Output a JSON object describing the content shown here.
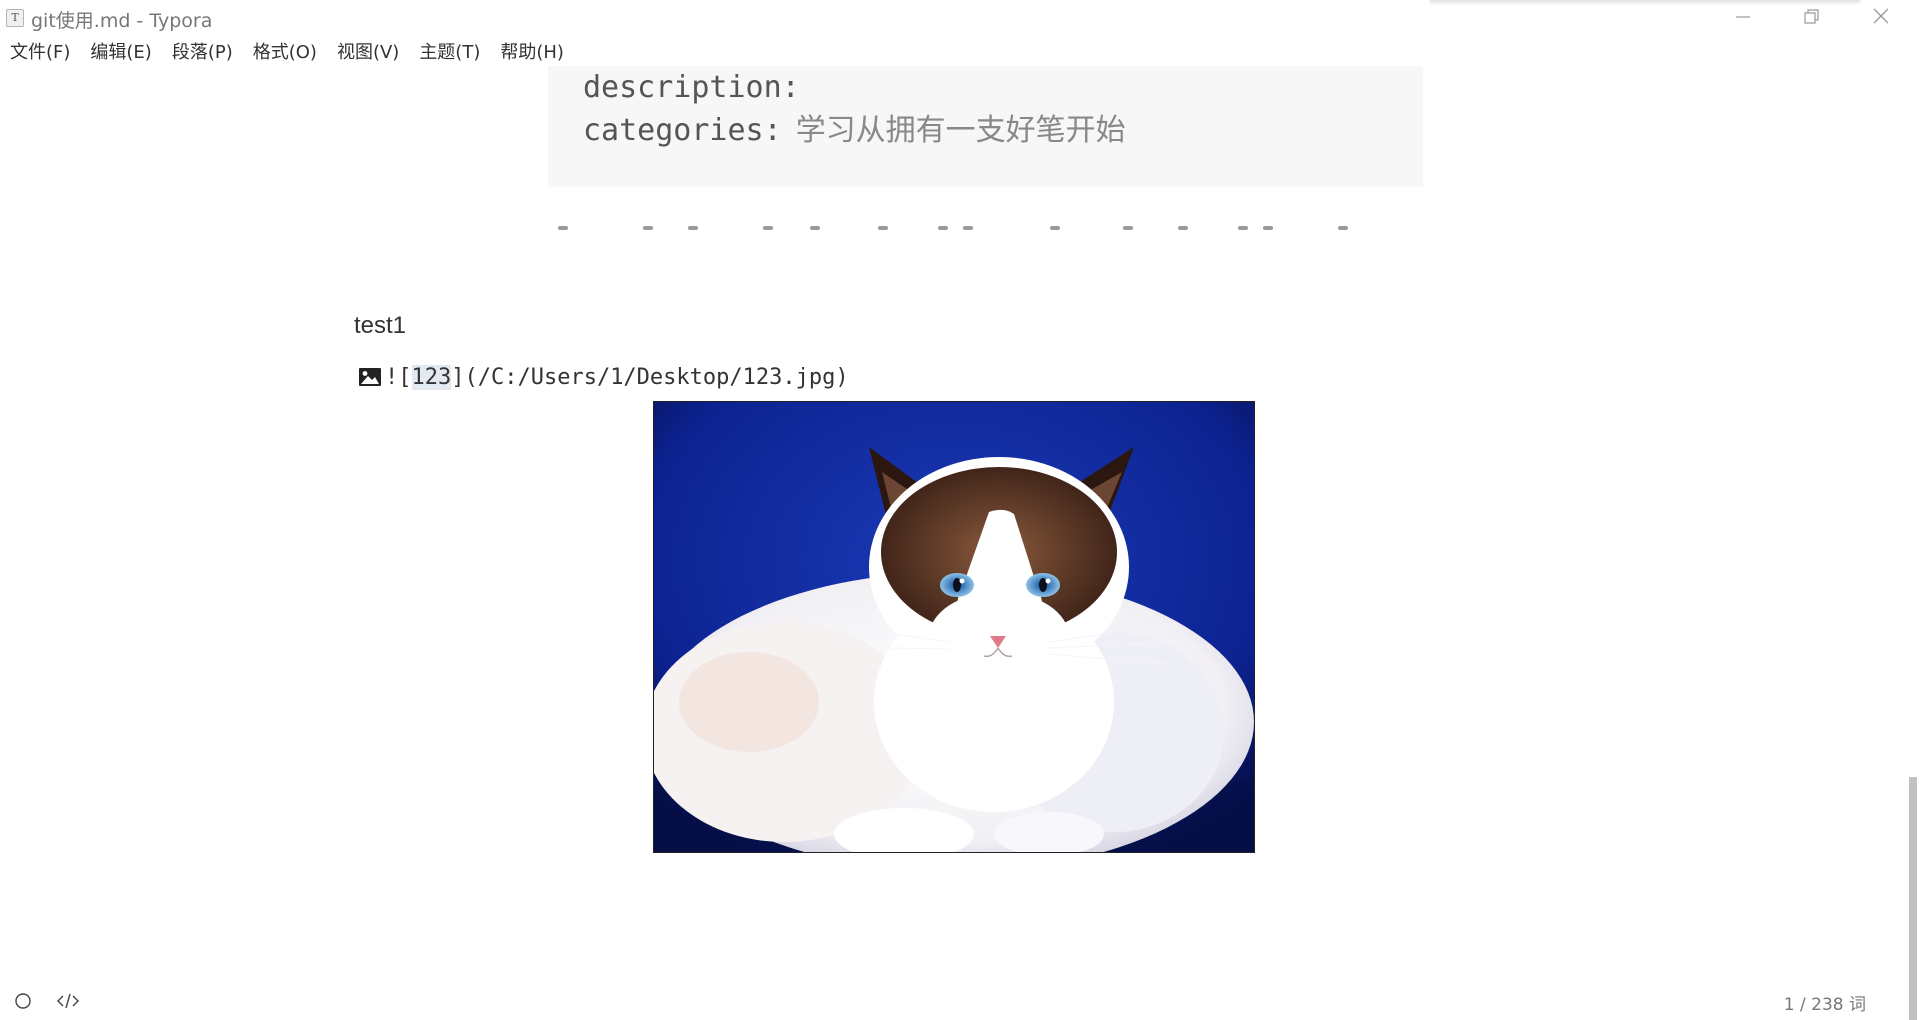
{
  "window": {
    "title": "git使用.md - Typora",
    "app_icon_letter": "T"
  },
  "menu": [
    {
      "label": "文件(F)"
    },
    {
      "label": "编辑(E)"
    },
    {
      "label": "段落(P)"
    },
    {
      "label": "格式(O)"
    },
    {
      "label": "视图(V)"
    },
    {
      "label": "主题(T)"
    },
    {
      "label": "帮助(H)"
    }
  ],
  "document": {
    "code_block": {
      "line1_key": "description:",
      "line2_key": "categories:",
      "line2_value": "学习从拥有一支好笔开始"
    },
    "paragraph": "test1",
    "image_markdown": {
      "prefix": "![",
      "alt": "123",
      "suffix": "](/C:/Users/1/Desktop/123.jpg)"
    },
    "image": {
      "subject": "ragdoll cat on blue background",
      "background_color": "#0a1f8c"
    }
  },
  "status": {
    "word_count": "1 / 238 词"
  },
  "icons": {
    "app": "typora-app-icon",
    "minimize": "minimize-icon",
    "maximize": "restore-icon",
    "close": "close-icon",
    "outline": "outline-circle-icon",
    "source": "source-code-icon",
    "image": "image-icon"
  }
}
